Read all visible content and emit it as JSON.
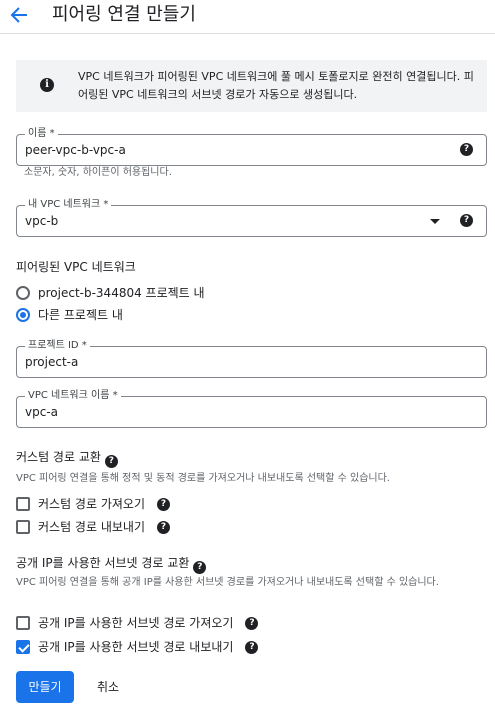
{
  "header": {
    "title": "피어링 연결 만들기"
  },
  "info": {
    "text": "VPC 네트워크가 피어링된 VPC 네트워크에 풀 메시 토폴로지로 완전히 연결됩니다. 피어링된 VPC 네트워크의 서브넷 경로가 자동으로 생성됩니다."
  },
  "name_field": {
    "label": "이름 *",
    "value": "peer-vpc-b-vpc-a",
    "hint": "소문자, 숫자, 하이픈이 허용됩니다."
  },
  "vpc_field": {
    "label": "내 VPC 네트워크 *",
    "value": "vpc-b"
  },
  "peered": {
    "title": "피어링된 VPC 네트워크",
    "options": [
      {
        "label": "project-b-344804 프로젝트 내",
        "selected": false
      },
      {
        "label": "다른 프로젝트 내",
        "selected": true
      }
    ]
  },
  "project_field": {
    "label": "프로젝트 ID *",
    "value": "project-a"
  },
  "vpc_name_field": {
    "label": "VPC 네트워크 이름 *",
    "value": "vpc-a"
  },
  "custom_routes": {
    "title": "커스텀 경로 교환",
    "desc": "VPC 피어링 연결을 통해 정적 및 동적 경로를 가져오거나 내보내도록 선택할 수 있습니다.",
    "options": [
      {
        "label": "커스텀 경로 가져오기",
        "checked": false
      },
      {
        "label": "커스텀 경로 내보내기",
        "checked": false
      }
    ]
  },
  "public_ip": {
    "title": "공개 IP를 사용한 서브넷 경로 교환",
    "desc": "VPC 피어링 연결을 통해 공개 IP를 사용한 서브넷 경로를 가져오거나 내보내도록 선택할 수 있습니다.",
    "options": [
      {
        "label": "공개 IP를 사용한 서브넷 경로 가져오기",
        "checked": false
      },
      {
        "label": "공개 IP를 사용한 서브넷 경로 내보내기",
        "checked": true
      }
    ]
  },
  "actions": {
    "create": "만들기",
    "cancel": "취소"
  },
  "colors": {
    "accent": "#1a73e8",
    "info_bg": "#f1f3f4",
    "border": "#80868b"
  },
  "icons": {
    "back": "arrow-back-icon",
    "info": "info-icon",
    "help": "help-icon",
    "dropdown": "dropdown-arrow-icon"
  }
}
